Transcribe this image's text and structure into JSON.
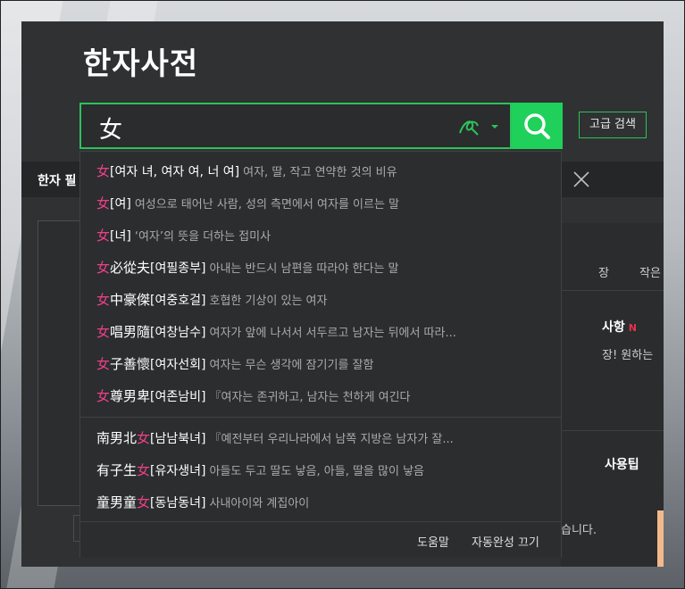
{
  "page": {
    "title": "한자사전",
    "advanced_search_label": "고급 검색"
  },
  "search": {
    "value": "女"
  },
  "background": {
    "tab_label": "한자 필",
    "right_text_1": "장",
    "right_text_2": "작은",
    "notice_title": "사항",
    "notice_badge": "N",
    "notice_text": "장! 원하는",
    "tips_title": "사용팁",
    "bottom_text": "습니다."
  },
  "suggestions": [
    {
      "pre": "",
      "hl": "女",
      "post": "",
      "reading": "[여자 녀, 여자 여, 너 여]",
      "meaning": "여자, 딸, 작고 연약한 것의 비유"
    },
    {
      "pre": "",
      "hl": "女",
      "post": "",
      "reading": "[여]",
      "meaning": "여성으로 태어난 사람, 성의 측면에서 여자를 이르는 말"
    },
    {
      "pre": "",
      "hl": "女",
      "post": "",
      "reading": "[녀]",
      "meaning": "‘여자’의 뜻을 더하는 접미사"
    },
    {
      "pre": "",
      "hl": "女",
      "post": "必從夫",
      "reading": "[여필종부]",
      "meaning": "아내는 반드시 남편을 따라야 한다는 말"
    },
    {
      "pre": "",
      "hl": "女",
      "post": "中豪傑",
      "reading": "[여중호걸]",
      "meaning": "호협한 기상이 있는 여자"
    },
    {
      "pre": "",
      "hl": "女",
      "post": "唱男隨",
      "reading": "[여창남수]",
      "meaning": "여자가 앞에 나서서 서두르고 남자는 뒤에서 따라..."
    },
    {
      "pre": "",
      "hl": "女",
      "post": "子善懷",
      "reading": "[여자선회]",
      "meaning": "여자는 무슨 생각에 잠기기를 잘함"
    },
    {
      "pre": "",
      "hl": "女",
      "post": "尊男卑",
      "reading": "[여존남비]",
      "meaning": "『여자는 존귀하고, 남자는 천하게 여긴다"
    },
    {
      "pre": "南男北",
      "hl": "女",
      "post": "",
      "reading": "[남남북녀]",
      "meaning": "『예전부터 우리나라에서 남쪽 지방은 남자가 잘..."
    },
    {
      "pre": "有子生",
      "hl": "女",
      "post": "",
      "reading": "[유자생녀]",
      "meaning": "아들도 두고 딸도 낳음, 아들, 딸을 많이 낳음"
    },
    {
      "pre": "童男童",
      "hl": "女",
      "post": "",
      "reading": "[동남동녀]",
      "meaning": "사내아이와 계집아이"
    }
  ],
  "footer": {
    "help_label": "도움말",
    "autocomplete_off_label": "자동완성 끄기"
  },
  "colors": {
    "accent": "#1fd15a",
    "highlight": "#f0408a",
    "panel": "#2f3133"
  }
}
